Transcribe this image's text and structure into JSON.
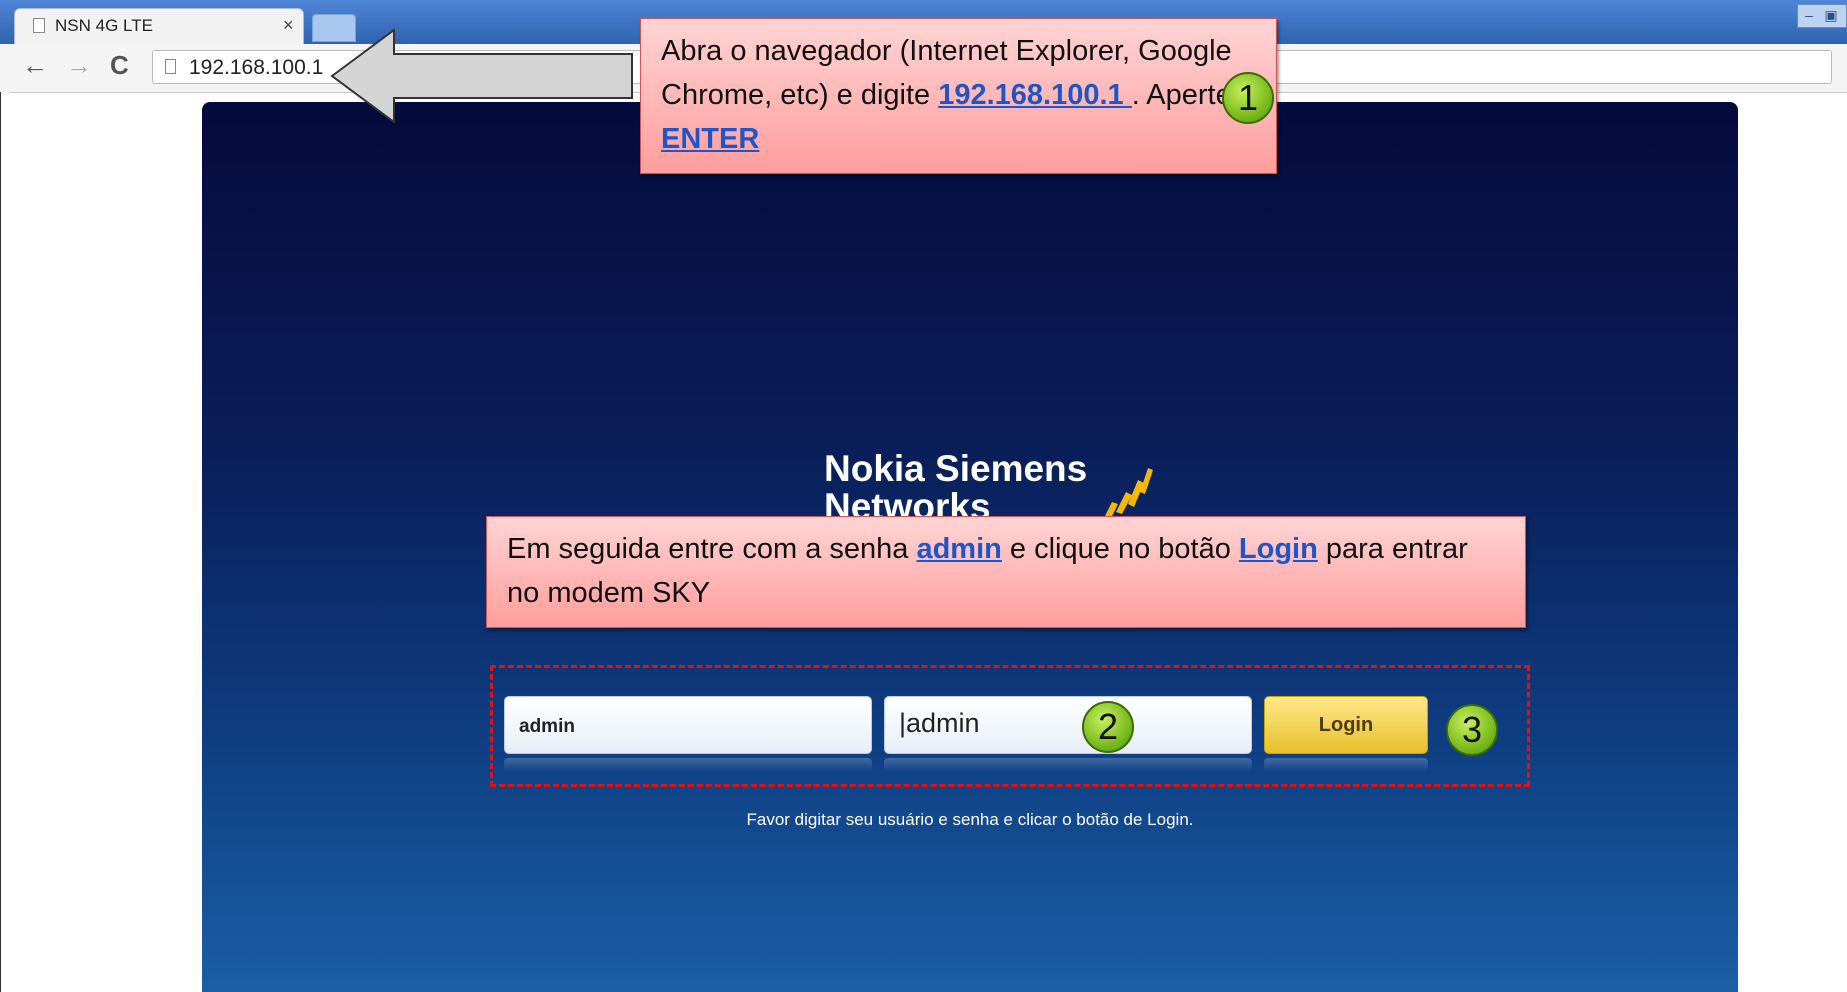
{
  "browser": {
    "tab_title": "NSN 4G LTE",
    "tab_close": "×",
    "url": "192.168.100.1",
    "nav_back": "←",
    "nav_forward": "→",
    "nav_reload": "C"
  },
  "page": {
    "logo_line1": "Nokia Siemens",
    "logo_line2": "Networks",
    "username_value": "admin",
    "password_value": "admin",
    "login_label": "Login",
    "help_text": "Favor digitar seu usuário e senha e clicar o botão de Login."
  },
  "annotations": {
    "step1": {
      "text_a": "Abra o navegador (Internet Explorer, Google Chrome, etc) e digite ",
      "link_ip": "192.168.100.1 ",
      "text_b": ". Aperte o ",
      "link_enter": "ENTER",
      "badge": "1"
    },
    "step2": {
      "text_a": "Em seguida entre com a senha ",
      "link_admin": "admin",
      "text_b": " e clique no botão ",
      "link_login": "Login",
      "text_c": " para entrar no modem SKY",
      "badge_password": "2",
      "badge_login": "3"
    }
  },
  "colors": {
    "panel_dark": "#050a3c",
    "panel_light": "#1a5fa6",
    "callout_fill": "#ffb3b3",
    "badge_green": "#8fd12a",
    "dashed_red": "#e01212",
    "link_blue": "#1f55c7"
  }
}
